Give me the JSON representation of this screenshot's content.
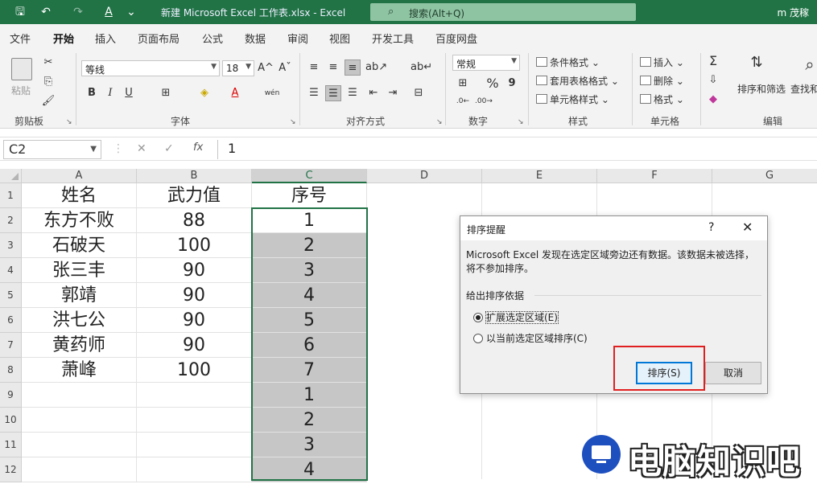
{
  "titlebar": {
    "title": "新建 Microsoft Excel 工作表.xlsx  -  Excel",
    "search_placeholder": "搜索(Alt+Q)",
    "user": "m 茂稼",
    "qa_save": "🖫",
    "qa_undo": "↶",
    "qa_redo": "↷",
    "qa_font": "A",
    "qa_more": "⌄"
  },
  "tabs": [
    "文件",
    "开始",
    "插入",
    "页面布局",
    "公式",
    "数据",
    "审阅",
    "视图",
    "开发工具",
    "百度网盘"
  ],
  "active_tab": "开始",
  "ribbon": {
    "clipboard": {
      "paste": "粘贴",
      "label": "剪贴板"
    },
    "font": {
      "name": "等线",
      "size": "18",
      "bold": "B",
      "italic": "I",
      "underline": "U",
      "label": "字体",
      "grow": "A^",
      "shrink": "Aˇ",
      "phonetic": "wén"
    },
    "alignment": {
      "label": "对齐方式"
    },
    "number": {
      "format": "常规",
      "percent": "%",
      "comma": "9",
      "label": "数字"
    },
    "styles": {
      "conditional": "条件格式",
      "table": "套用表格格式",
      "cell": "单元格样式",
      "label": "样式"
    },
    "cells": {
      "insert": "插入",
      "delete": "删除",
      "format": "格式",
      "label": "单元格"
    },
    "editing": {
      "sum": "Σ",
      "sort_filter": "排序和筛选",
      "find": "查找和",
      "label": "编辑"
    }
  },
  "formula_bar": {
    "name_box": "C2",
    "cancel": "✕",
    "enter": "✓",
    "fx": "fx",
    "value": "1"
  },
  "columns": [
    "A",
    "B",
    "C",
    "D",
    "E",
    "F",
    "G"
  ],
  "rows": [
    "1",
    "2",
    "3",
    "4",
    "5",
    "6",
    "7",
    "8",
    "9",
    "10",
    "11",
    "12"
  ],
  "cells": [
    [
      "姓名",
      "武力值",
      "序号"
    ],
    [
      "东方不败",
      "88",
      "1"
    ],
    [
      "石破天",
      "100",
      "2"
    ],
    [
      "张三丰",
      "90",
      "3"
    ],
    [
      "郭靖",
      "90",
      "4"
    ],
    [
      "洪七公",
      "90",
      "5"
    ],
    [
      "黄药师",
      "90",
      "6"
    ],
    [
      "萧峰",
      "100",
      "7"
    ],
    [
      "",
      "",
      "1"
    ],
    [
      "",
      "",
      "2"
    ],
    [
      "",
      "",
      "3"
    ],
    [
      "",
      "",
      "4"
    ]
  ],
  "dialog": {
    "title": "排序提醒",
    "help": "?",
    "close": "✕",
    "message": "Microsoft Excel 发现在选定区域旁边还有数据。该数据未被选择，将不参加排序。",
    "section": "给出排序依据",
    "option_expand": "扩展选定区域(E)",
    "option_current": "以当前选定区域排序(C)",
    "sort_button": "排序(S)",
    "cancel_button": "取消"
  },
  "watermark": {
    "text": "电脑知识吧"
  }
}
